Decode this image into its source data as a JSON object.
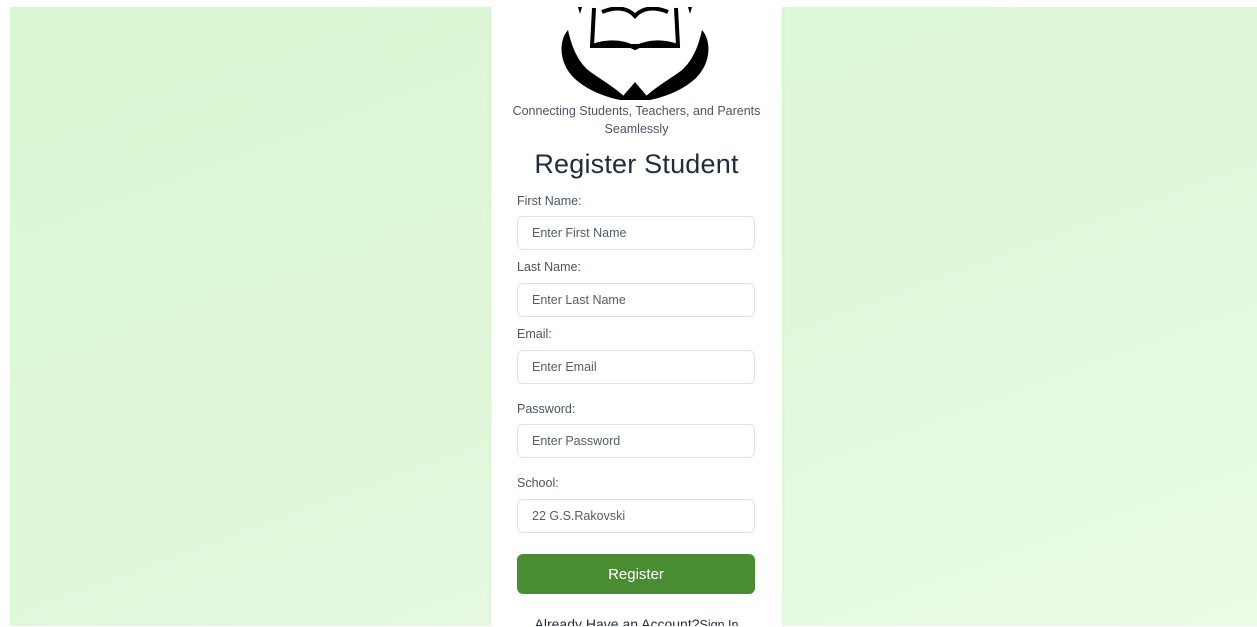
{
  "brand": {
    "tagline": "Connecting Students, Teachers, and Parents Seamlessly",
    "logo_icon": "open-book-in-hands-icon"
  },
  "form": {
    "title": "Register Student",
    "fields": {
      "first_name": {
        "label": "First Name:",
        "placeholder": "Enter First Name",
        "value": ""
      },
      "last_name": {
        "label": "Last Name:",
        "placeholder": "Enter Last Name",
        "value": ""
      },
      "email": {
        "label": "Email:",
        "placeholder": "Enter Email",
        "value": ""
      },
      "password": {
        "label": "Password:",
        "placeholder": "Enter Password",
        "value": ""
      },
      "school": {
        "label": "School:",
        "value": "22 G.S.Rakovski"
      }
    },
    "submit_label": "Register",
    "signin_prompt": "Already Have an Account?",
    "signin_link": "Sign In"
  },
  "colors": {
    "background": "#dcf7d6",
    "card": "#ffffff",
    "button": "#4a8c32",
    "title_text": "#1f2d3d"
  }
}
